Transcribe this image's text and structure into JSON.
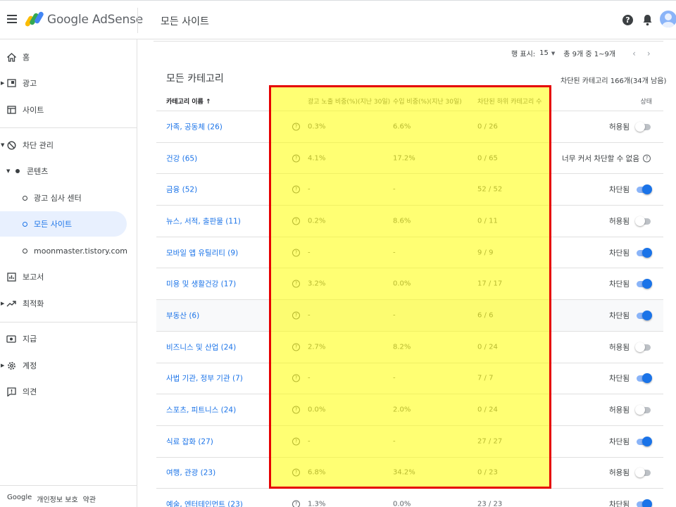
{
  "app": {
    "brand": "Google AdSense",
    "page_title": "모든 사이트"
  },
  "sidebar": {
    "items": [
      {
        "label": "홈"
      },
      {
        "label": "광고"
      },
      {
        "label": "사이트"
      },
      {
        "label": "차단 관리"
      },
      {
        "label": "콘텐츠"
      },
      {
        "label": "광고 심사 센터"
      },
      {
        "label": "모든 사이트"
      },
      {
        "label": "moonmaster.tistory.com"
      },
      {
        "label": "보고서"
      },
      {
        "label": "최적화"
      },
      {
        "label": "지급"
      },
      {
        "label": "계정"
      },
      {
        "label": "의견"
      }
    ],
    "footer": {
      "google": "Google",
      "privacy": "개인정보 보호",
      "terms": "약관"
    }
  },
  "pager": {
    "rows_label": "행 표시:",
    "rows_value": "15",
    "range": "총 9개 중 1~9개",
    "prev": "‹",
    "next": "›"
  },
  "section": {
    "title": "모든 카테고리",
    "blocked_count": "차단된 카테고리 166개(34개 남음)"
  },
  "table": {
    "headers": {
      "name": "카테고리 이름 ↑",
      "impressions": "광고 노출 비중(%)(지난 30일)",
      "revenue": "수입 비중(%)(지난 30일)",
      "subcats": "차단된 하위 카테고리 수",
      "status": "상태"
    },
    "rows": [
      {
        "name": "가족, 공동체 (26)",
        "impressions": "0.3%",
        "revenue": "6.6%",
        "subcats": "0 / 26",
        "status": "허용됨",
        "toggle": "off"
      },
      {
        "name": "건강 (65)",
        "impressions": "4.1%",
        "revenue": "17.2%",
        "subcats": "0 / 65",
        "status": "너무 커서 차단할 수 없음",
        "toggle": "none"
      },
      {
        "name": "금융 (52)",
        "impressions": "-",
        "revenue": "-",
        "subcats": "52 / 52",
        "status": "차단됨",
        "toggle": "on"
      },
      {
        "name": "뉴스, 서적, 출판물 (11)",
        "impressions": "0.2%",
        "revenue": "8.6%",
        "subcats": "0 / 11",
        "status": "허용됨",
        "toggle": "off"
      },
      {
        "name": "모바일 앱 유틸리티 (9)",
        "impressions": "-",
        "revenue": "-",
        "subcats": "9 / 9",
        "status": "차단됨",
        "toggle": "on"
      },
      {
        "name": "미용 및 생활건강 (17)",
        "impressions": "3.2%",
        "revenue": "0.0%",
        "subcats": "17 / 17",
        "status": "차단됨",
        "toggle": "on"
      },
      {
        "name": "부동산 (6)",
        "impressions": "-",
        "revenue": "-",
        "subcats": "6 / 6",
        "status": "차단됨",
        "toggle": "on"
      },
      {
        "name": "비즈니스 및 산업 (24)",
        "impressions": "2.7%",
        "revenue": "8.2%",
        "subcats": "0 / 24",
        "status": "허용됨",
        "toggle": "off"
      },
      {
        "name": "사법 기관, 정부 기관 (7)",
        "impressions": "-",
        "revenue": "-",
        "subcats": "7 / 7",
        "status": "차단됨",
        "toggle": "on"
      },
      {
        "name": "스포츠, 피트니스 (24)",
        "impressions": "0.0%",
        "revenue": "2.0%",
        "subcats": "0 / 24",
        "status": "허용됨",
        "toggle": "off"
      },
      {
        "name": "식료 잡화 (27)",
        "impressions": "-",
        "revenue": "-",
        "subcats": "27 / 27",
        "status": "차단됨",
        "toggle": "on"
      },
      {
        "name": "여행, 관광 (23)",
        "impressions": "6.8%",
        "revenue": "34.2%",
        "subcats": "0 / 23",
        "status": "허용됨",
        "toggle": "off"
      },
      {
        "name": "예술, 엔터테인먼트 (23)",
        "impressions": "1.3%",
        "revenue": "0.0%",
        "subcats": "23 / 23",
        "status": "차단됨",
        "toggle": "on"
      }
    ]
  },
  "colors": {
    "accent": "#1a73e8",
    "highlight_fill": "#ffff00",
    "highlight_border": "#e50000"
  }
}
